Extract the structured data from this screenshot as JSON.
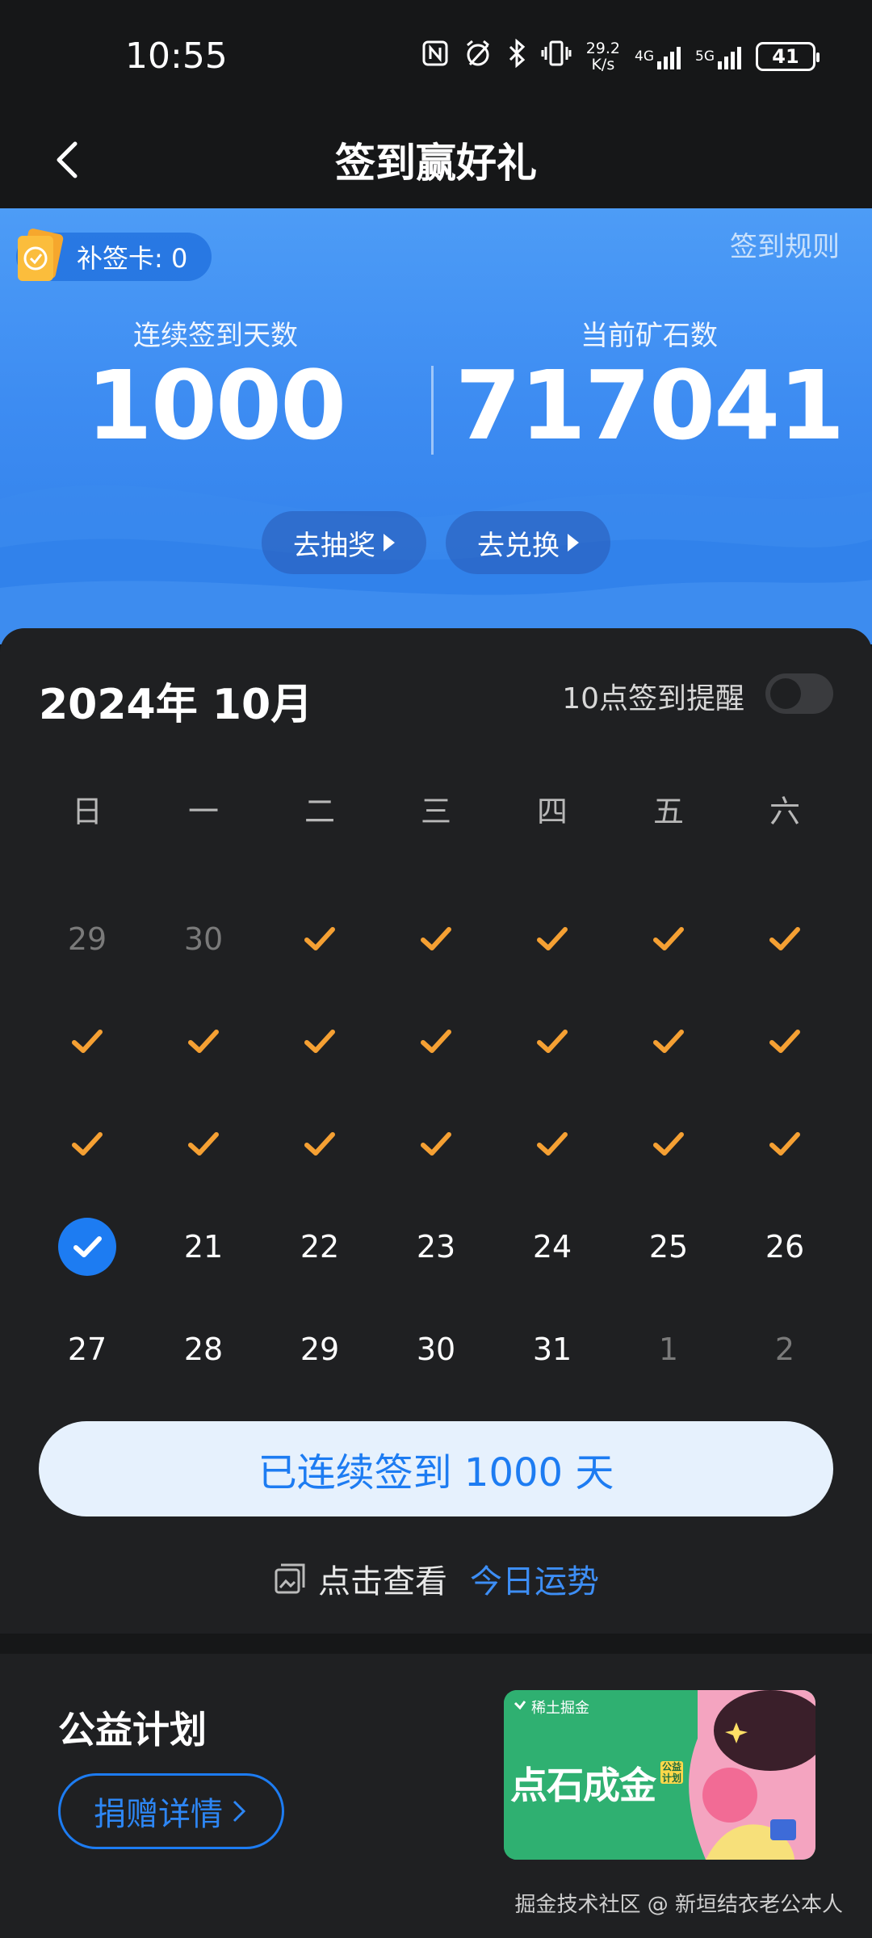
{
  "status": {
    "time": "10:55",
    "net_speed_value": "29.2",
    "net_speed_unit": "K/s",
    "sig1": "4G",
    "sig2": "5G",
    "battery": "41"
  },
  "nav": {
    "title": "签到赢好礼"
  },
  "hero": {
    "makeup_card": "补签卡: 0",
    "rules_link": "签到规则",
    "streak_label": "连续签到天数",
    "streak_value": "1000",
    "ore_label": "当前矿石数",
    "ore_value": "717041",
    "lottery_btn": "去抽奖",
    "exchange_btn": "去兑换"
  },
  "calendar": {
    "month_title": "2024年 10月",
    "remind_label": "10点签到提醒",
    "remind_on": false,
    "weekdays": [
      "日",
      "一",
      "二",
      "三",
      "四",
      "五",
      "六"
    ],
    "rows": [
      [
        {
          "t": "29",
          "s": "muted"
        },
        {
          "t": "30",
          "s": "muted"
        },
        {
          "t": "",
          "s": "check"
        },
        {
          "t": "",
          "s": "check"
        },
        {
          "t": "",
          "s": "check"
        },
        {
          "t": "",
          "s": "check"
        },
        {
          "t": "",
          "s": "check"
        }
      ],
      [
        {
          "t": "",
          "s": "check"
        },
        {
          "t": "",
          "s": "check"
        },
        {
          "t": "",
          "s": "check"
        },
        {
          "t": "",
          "s": "check"
        },
        {
          "t": "",
          "s": "check"
        },
        {
          "t": "",
          "s": "check"
        },
        {
          "t": "",
          "s": "check"
        }
      ],
      [
        {
          "t": "",
          "s": "check"
        },
        {
          "t": "",
          "s": "check"
        },
        {
          "t": "",
          "s": "check"
        },
        {
          "t": "",
          "s": "check"
        },
        {
          "t": "",
          "s": "check"
        },
        {
          "t": "",
          "s": "check"
        },
        {
          "t": "",
          "s": "check"
        }
      ],
      [
        {
          "t": "",
          "s": "today"
        },
        {
          "t": "21",
          "s": "normal"
        },
        {
          "t": "22",
          "s": "normal"
        },
        {
          "t": "23",
          "s": "normal"
        },
        {
          "t": "24",
          "s": "normal"
        },
        {
          "t": "25",
          "s": "normal"
        },
        {
          "t": "26",
          "s": "normal"
        }
      ],
      [
        {
          "t": "27",
          "s": "normal"
        },
        {
          "t": "28",
          "s": "normal"
        },
        {
          "t": "29",
          "s": "normal"
        },
        {
          "t": "30",
          "s": "normal"
        },
        {
          "t": "31",
          "s": "normal"
        },
        {
          "t": "1",
          "s": "muted"
        },
        {
          "t": "2",
          "s": "muted"
        }
      ]
    ],
    "streak_button": "已连续签到  1000  天",
    "fortune_text": "点击查看",
    "fortune_link": "今日运势"
  },
  "charity": {
    "title": "公益计划",
    "donate_btn": "捐赠详情",
    "banner_brand": "稀土掘金",
    "banner_title": "点石成金",
    "banner_tag": "公益计划",
    "watermark": "掘金技术社区 @ 新垣结衣老公本人"
  },
  "colors": {
    "accent": "#1d7cf2",
    "check": "#f5a033",
    "background": "#161718",
    "card": "#1f2022"
  },
  "icons": [
    "nfc-icon",
    "alarm-icon",
    "bluetooth-icon",
    "vibrate-icon",
    "back-arrow-icon",
    "makeup-card-icon",
    "checkmark-icon",
    "fortune-icon",
    "chevron-right-icon"
  ]
}
